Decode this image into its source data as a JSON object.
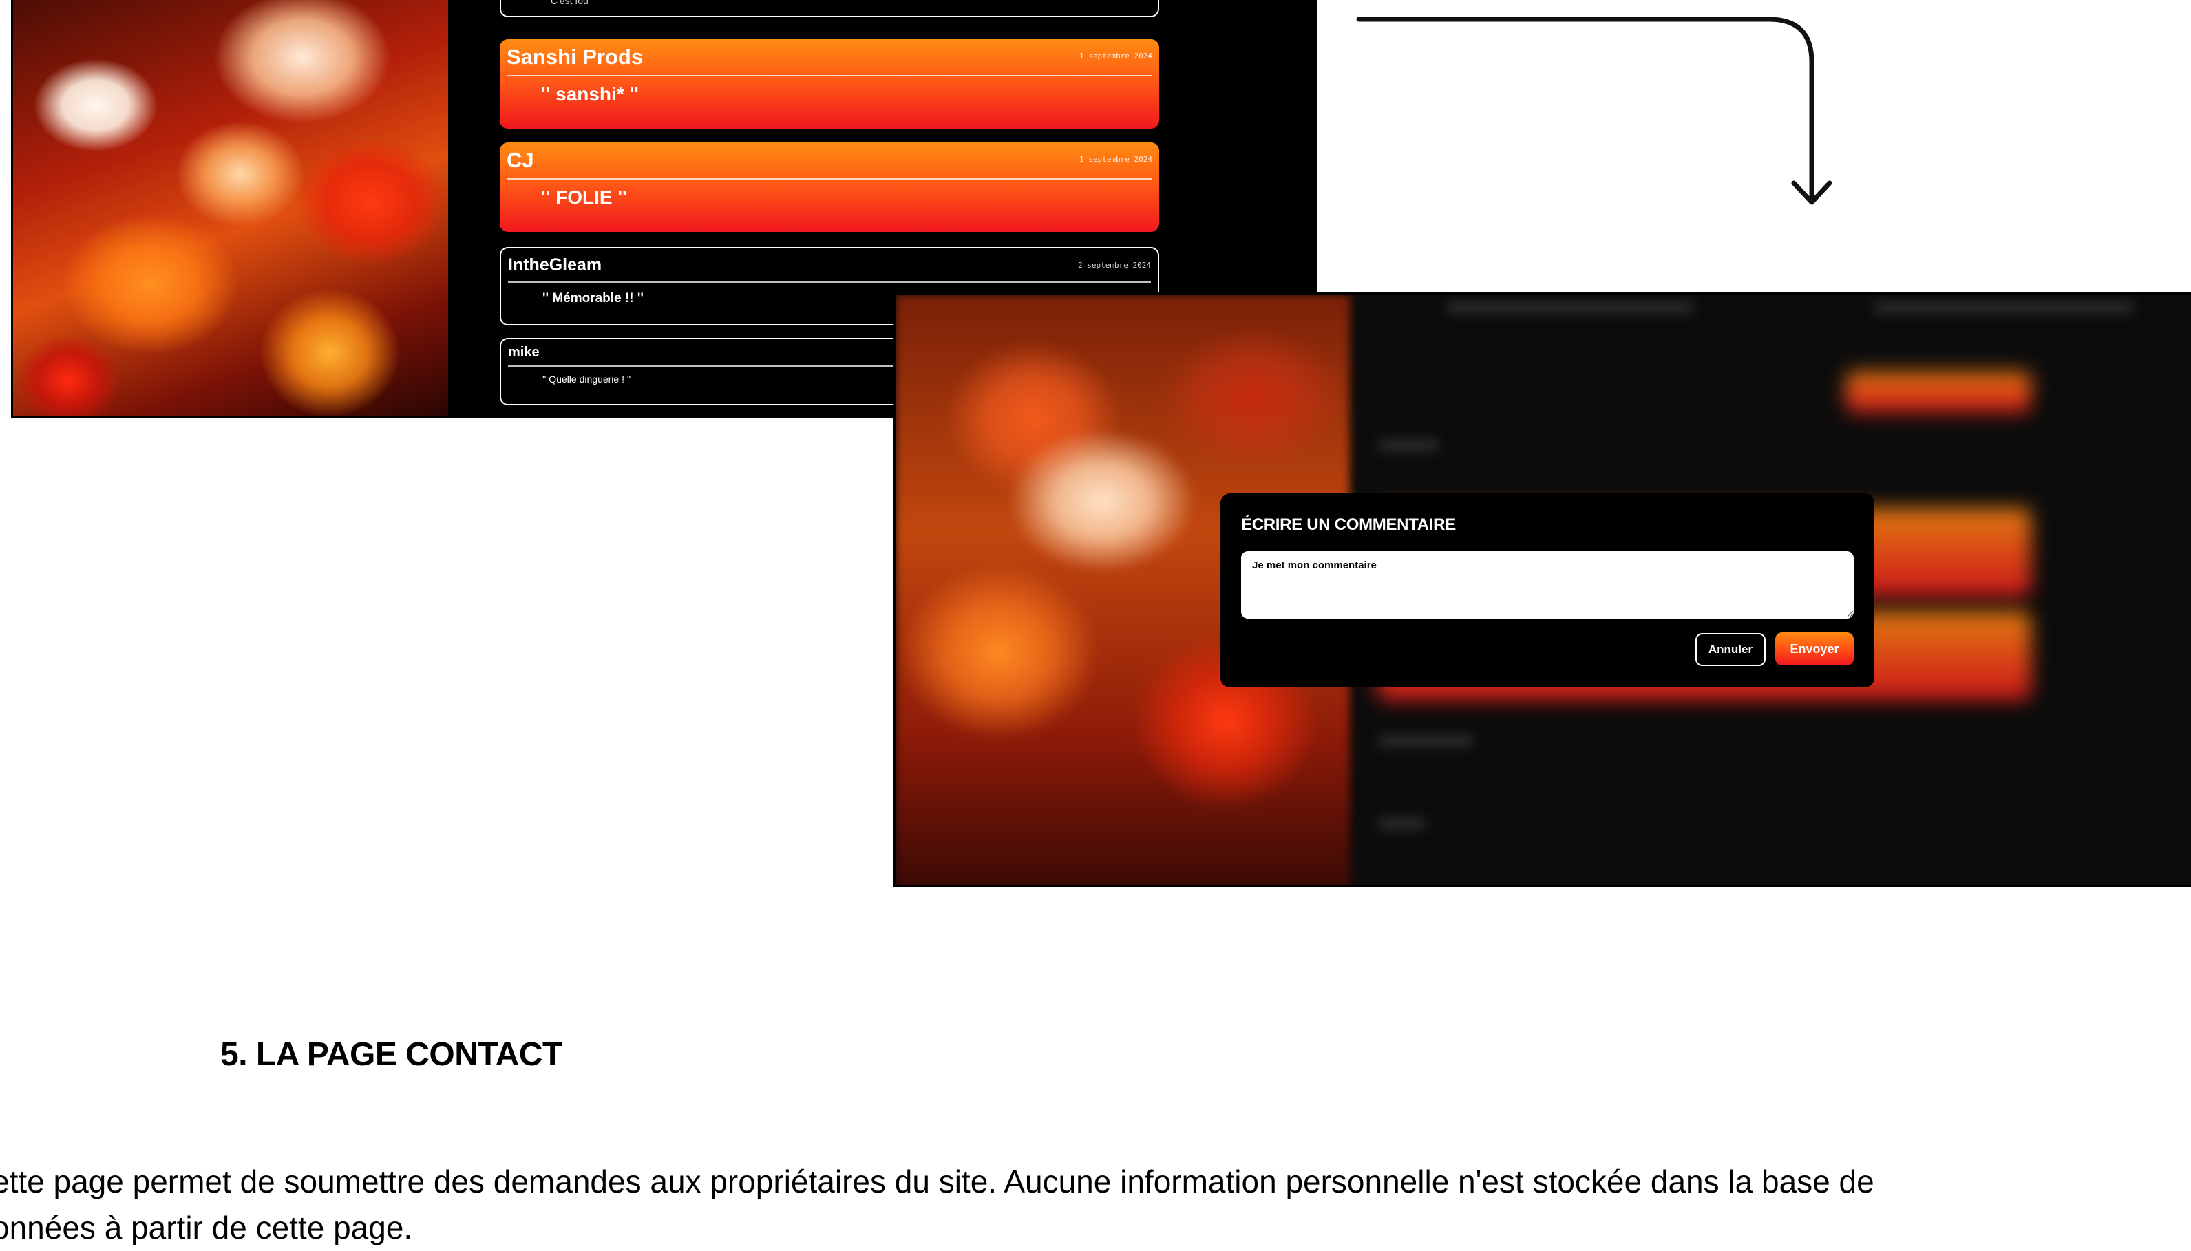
{
  "comments": [
    {
      "author": "",
      "date": "",
      "text": "C'est fou",
      "style": "top"
    },
    {
      "author": "Sanshi Prods",
      "date": "1 septembre 2024",
      "text": "'' sanshi* ''",
      "style": "hot"
    },
    {
      "author": "CJ",
      "date": "1 septembre 2024",
      "text": "'' FOLIE ''",
      "style": "hot"
    },
    {
      "author": "IntheGleam",
      "date": "2 septembre 2024",
      "text": "'' Mémorable !! ''",
      "style": "plain"
    },
    {
      "author": "mike",
      "date": "",
      "text": "'' Quelle dinguerie ! ''",
      "style": "small"
    }
  ],
  "modal": {
    "title": "ÉCRIRE UN COMMENTAIRE",
    "textarea_value": "Je met mon commentaire",
    "cancel_label": "Annuler",
    "send_label": "Envoyer"
  },
  "section": {
    "title": "5. LA PAGE CONTACT",
    "paragraph_line1": "ette page permet de soumettre des demandes aux propriétaires du site. Aucune information personnelle n'est stockée dans la base de",
    "paragraph_line2": "onnées à partir de cette page."
  },
  "colors": {
    "accent_orange": "#ff8c12",
    "accent_red": "#f0181e",
    "dark": "#000000"
  }
}
